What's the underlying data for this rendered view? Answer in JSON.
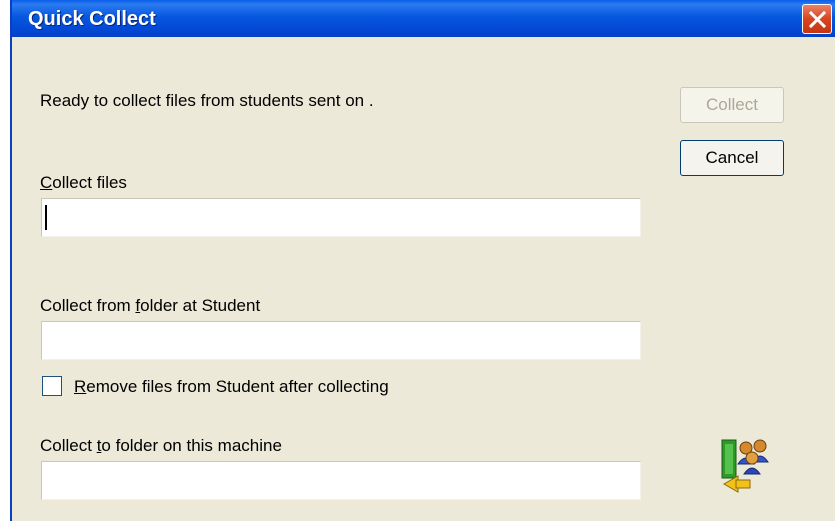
{
  "window": {
    "title": "Quick Collect"
  },
  "status_text": "Ready to collect files from students sent on .",
  "buttons": {
    "collect": "Collect",
    "cancel": "Cancel"
  },
  "collect_files": {
    "label_accel": "C",
    "label_rest": "ollect files",
    "value": ""
  },
  "collect_from_folder": {
    "label_pre": "Collect from ",
    "label_accel": "f",
    "label_post": "older at Student",
    "value": ""
  },
  "remove_files": {
    "label_accel": "R",
    "label_rest": "emove files from Student after collecting",
    "checked": false
  },
  "collect_to_folder": {
    "label_pre": "Collect ",
    "label_accel": "t",
    "label_post": "o folder on this machine",
    "value": ""
  },
  "icons": {
    "close": "close-icon",
    "app": "collect-files-icon"
  },
  "colors": {
    "titlebar": "#0a5fe8",
    "dialog_bg": "#ece9d8",
    "close_red": "#d8451f"
  }
}
